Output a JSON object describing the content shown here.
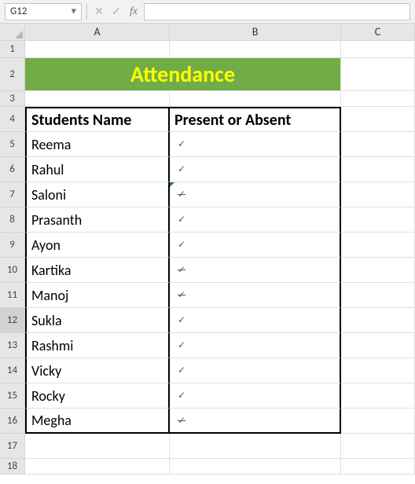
{
  "namebox": "G12",
  "fx": "fx",
  "cols": [
    "A",
    "B",
    "C"
  ],
  "title": "Attendance",
  "headers": {
    "a": "Students Name",
    "b": "Present or Absent"
  },
  "rows": [
    {
      "n": 5,
      "name": "Reema",
      "mark": "✓",
      "abs": false,
      "tri": false
    },
    {
      "n": 6,
      "name": "Rahul",
      "mark": "✓",
      "abs": false,
      "tri": false
    },
    {
      "n": 7,
      "name": "Saloni",
      "mark": "✓",
      "abs": true,
      "tri": true
    },
    {
      "n": 8,
      "name": "Prasanth",
      "mark": "✓",
      "abs": false,
      "tri": false
    },
    {
      "n": 9,
      "name": "Ayon",
      "mark": "✓",
      "abs": false,
      "tri": false
    },
    {
      "n": 10,
      "name": "Kartika",
      "mark": "✓",
      "abs": true,
      "tri": false
    },
    {
      "n": 11,
      "name": "Manoj",
      "mark": "✓",
      "abs": true,
      "tri": false
    },
    {
      "n": 12,
      "name": "Sukla",
      "mark": "✓",
      "abs": false,
      "tri": false
    },
    {
      "n": 13,
      "name": "Rashmi",
      "mark": "✓",
      "abs": false,
      "tri": false
    },
    {
      "n": 14,
      "name": "Vicky",
      "mark": "✓",
      "abs": false,
      "tri": false
    },
    {
      "n": 15,
      "name": "Rocky",
      "mark": "✓",
      "abs": false,
      "tri": false
    },
    {
      "n": 16,
      "name": "Megha",
      "mark": "✓",
      "abs": true,
      "tri": false
    }
  ],
  "tailRows": [
    17,
    18
  ]
}
